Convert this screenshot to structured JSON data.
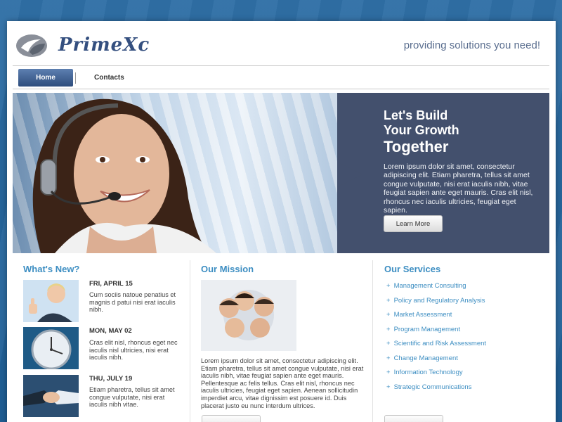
{
  "brand": {
    "name": "PrimeXc",
    "tagline": "providing solutions you need!",
    "accent": "#3d8ec2",
    "navy": "#43506d"
  },
  "nav": {
    "items": [
      {
        "label": "Home",
        "active": true
      },
      {
        "label": "Contacts",
        "active": false
      }
    ]
  },
  "hero": {
    "title_line1": "Let's Build",
    "title_line2": "Your Growth",
    "title_line3": "Together",
    "body": "Lorem ipsum dolor sit amet, consectetur adipiscing elit. Etiam pharetra, tellus sit amet congue vulputate, nisi erat iaculis nibh, vitae feugiat sapien ante eget mauris. Cras elit nisl, rhoncus nec iaculis ultricies, feugiat eget sapien.",
    "button_label": "Learn More"
  },
  "whats_new": {
    "title": "What's New?",
    "items": [
      {
        "date": "FRI, APRIL 15",
        "text": "Cum sociis natoue penatius et magnis d patui nisi erat iaculis nibh.",
        "thumb_icon": "thumbs-up-person"
      },
      {
        "date": "MON, MAY 02",
        "text": "Cras elit nisl, rhoncus eget nec iaculis nisl ultricies, nisi erat iaculis nibh.",
        "thumb_icon": "clock"
      },
      {
        "date": "THU, JULY 19",
        "text": "Etiam pharetra, tellus sit amet congue vulputate, nisi erat iaculis nibh vitae.",
        "thumb_icon": "handshake"
      }
    ]
  },
  "mission": {
    "title": "Our Mission",
    "image_icon": "team-circle",
    "text": "Lorem ipsum dolor sit amet, consectetur adipiscing elit. Etiam pharetra, tellus sit amet congue vulputate, nisi erat iaculis nibh, vitae feugiat sapien ante eget mauris. Pellentesque ac felis tellus. Cras elit nisl, rhoncus nec iaculis ultricies, feugiat eget sapien. Aenean sollicitudin imperdiet arcu, vitae dignissim est posuere id. Duis placerat justo eu nunc interdum ultrices."
  },
  "services": {
    "title": "Our Services",
    "items": [
      "Management Consulting",
      "Policy and Regulatory Analysis",
      "Market Assessment",
      "Program Management",
      "Scientific and Risk Assessment",
      "Change Management",
      "Information Technology",
      "Strategic Communications"
    ]
  }
}
